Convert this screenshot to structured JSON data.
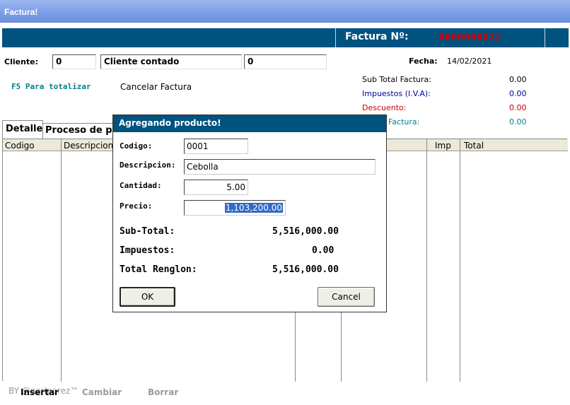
{
  "window": {
    "title": "Factura!"
  },
  "header": {
    "factura_label": "Factura Nº:",
    "factura_number": "0000000022"
  },
  "client": {
    "label": "Cliente:",
    "code_value": "0",
    "name_value": "Cliente contado",
    "extra_value": "0"
  },
  "date": {
    "label": "Fecha:",
    "value": "14/02/2021"
  },
  "hints": {
    "f5": "F5 Para totalizar",
    "cancel": "Cancelar Factura"
  },
  "summary": {
    "subtotal_label": "Sub Total Factura:",
    "subtotal_value": "0.00",
    "tax_label": "Impuestos (I.V.A):",
    "tax_value": "0.00",
    "discount_label": "Descuento:",
    "discount_value": "0.00",
    "total_label": "Factura:",
    "total_value": "0.00"
  },
  "tabs": {
    "detalle": "Detalle",
    "proceso": "Proceso de pa"
  },
  "grid": {
    "columns": [
      "Codigo",
      "Descripcion",
      "Imp",
      "Total"
    ]
  },
  "bottom": {
    "watermark": "BY @neriperez™",
    "insertar": "Insertar",
    "cambiar": "Cambiar",
    "borrar": "Borrar"
  },
  "dialog": {
    "title": "Agregando producto!",
    "codigo_label": "Codigo:",
    "codigo_value": "0001",
    "descripcion_label": "Descripcion:",
    "descripcion_value": "Cebolla",
    "cantidad_label": "Cantidad:",
    "cantidad_value": "5.00",
    "precio_label": "Precio:",
    "precio_value": "1,103,200.00",
    "subtotal_label": "Sub-Total:",
    "subtotal_value": "5,516,000.00",
    "impuestos_label": "Impuestos:",
    "impuestos_value": "0.00",
    "total_label": "Total Renglon:",
    "total_value": "5,516,000.00",
    "ok_label": "OK",
    "cancel_label": "Cancel"
  },
  "colors": {
    "header_blue": "#00527f",
    "number_red": "#d80000",
    "teal": "#00808c",
    "tax_blue": "#000099",
    "discount_red": "#cc0000"
  }
}
